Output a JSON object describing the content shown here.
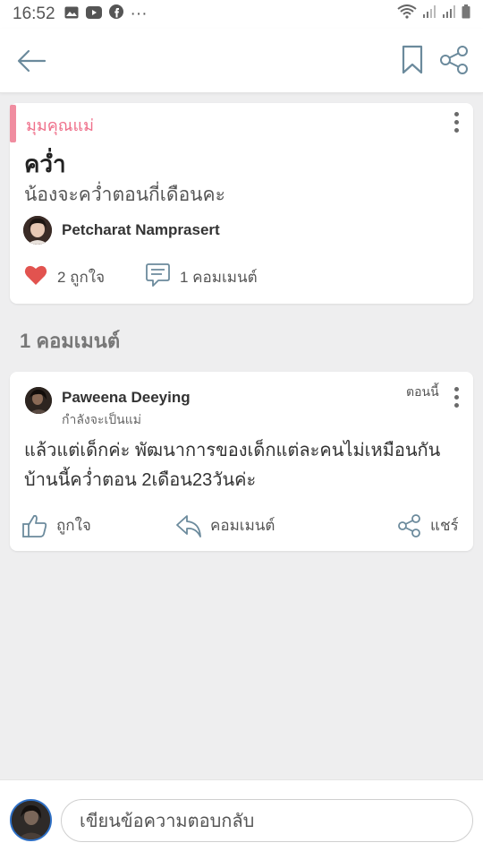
{
  "status_bar": {
    "time": "16:52",
    "icons_left": [
      "gallery-icon",
      "youtube-icon",
      "facebook-icon",
      "more-icon"
    ],
    "icons_right": [
      "wifi-icon",
      "signal-icon",
      "signal-icon",
      "battery-icon"
    ],
    "more_glyph": "···"
  },
  "post": {
    "category": "มุมคุณแม่",
    "title": "คว่ำ",
    "body": "น้องจะคว่ำตอนกี่เดือนคะ",
    "author": "Petcharat Namprasert",
    "likes": "2 ถูกใจ",
    "comments": "1 คอมเมนต์"
  },
  "comments_heading": "1 คอมเมนต์",
  "comment": {
    "author": "Paweena Deeying",
    "role": "กำลังจะเป็นแม่",
    "time": "ตอนนี้",
    "text": "แล้วแต่เด็กค่ะ พัฒนาการของเด็กแต่ละคนไม่เหมือนกัน บ้านนี้คว่ำตอน 2เดือน23วันค่ะ",
    "actions": {
      "like": "ถูกใจ",
      "comment": "คอมเมนต์",
      "share": "แชร์"
    }
  },
  "reply": {
    "placeholder": "เขียนข้อความตอบกลับ"
  },
  "colors": {
    "accent_pink": "#ef6f8a",
    "heart_red": "#e2534f",
    "background": "#eeeeef"
  }
}
